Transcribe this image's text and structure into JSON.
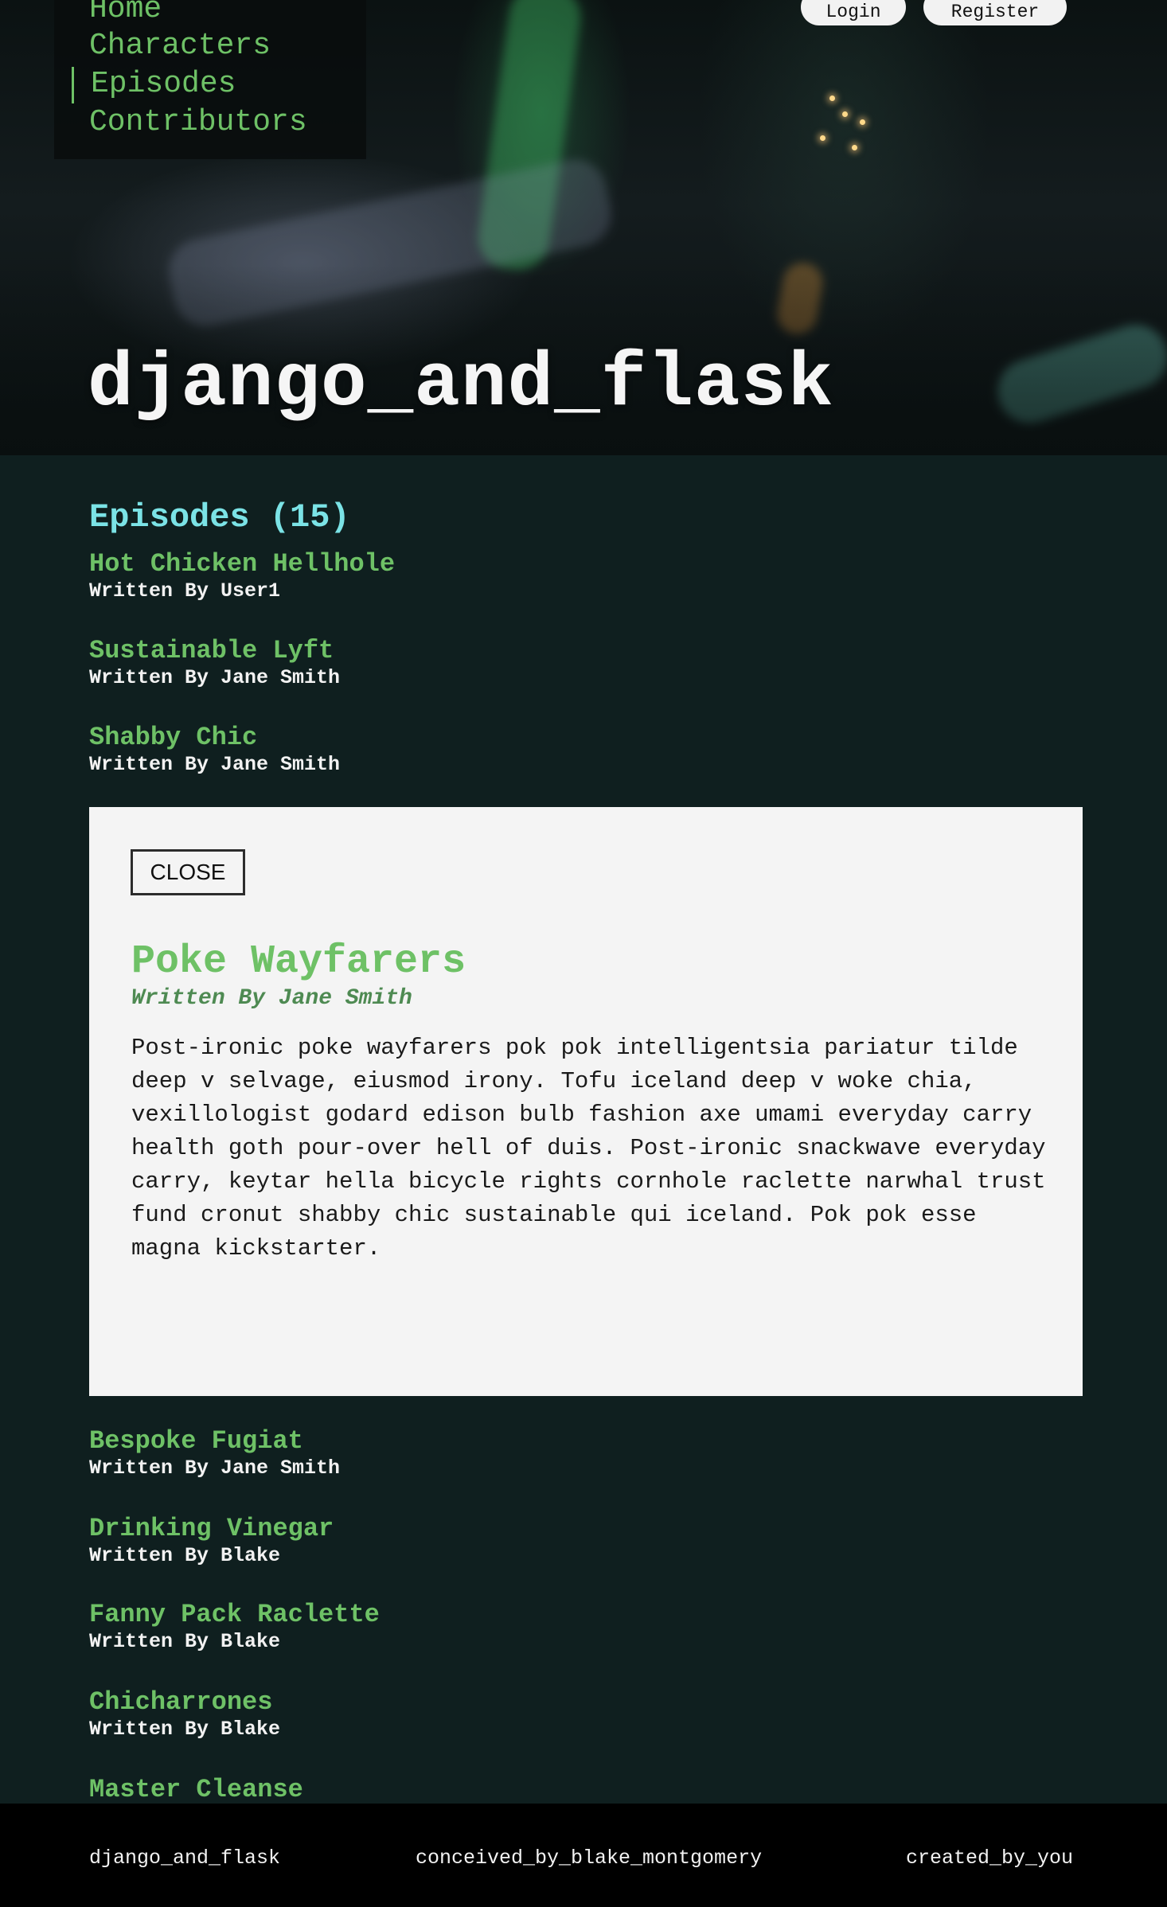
{
  "nav": {
    "items": [
      {
        "label": "Home"
      },
      {
        "label": "Characters"
      },
      {
        "label": "Episodes"
      },
      {
        "label": "Contributors"
      }
    ],
    "active": "Episodes"
  },
  "auth": {
    "login_label": "Login",
    "register_label": "Register"
  },
  "site_title": "django_and_flask",
  "episodes_heading": "Episodes (15)",
  "episodes": [
    {
      "title": "Hot Chicken Hellhole",
      "author": "Written By User1"
    },
    {
      "title": "Sustainable Lyft",
      "author": "Written By Jane Smith"
    },
    {
      "title": "Shabby Chic",
      "author": "Written By Jane Smith"
    },
    {
      "title": "Bespoke Fugiat",
      "author": "Written By Jane Smith"
    },
    {
      "title": "Drinking Vinegar",
      "author": "Written By Blake"
    },
    {
      "title": "Fanny Pack Raclette",
      "author": "Written By Blake"
    },
    {
      "title": "Chicharrones",
      "author": "Written By Blake"
    },
    {
      "title": "Master Cleanse",
      "author": ""
    }
  ],
  "modal": {
    "close_label": "CLOSE",
    "title": "Poke Wayfarers",
    "author": "Written By Jane Smith",
    "body": "Post-ironic poke wayfarers pok pok intelligentsia pariatur tilde deep v selvage, eiusmod irony. Tofu iceland deep v woke chia, vexillologist godard edison bulb fashion axe umami everyday carry health goth pour-over hell of duis. Post-ironic snackwave everyday carry, keytar hella bicycle rights cornhole raclette narwhal trust fund cronut shabby chic sustainable qui iceland. Pok pok esse magna kickstarter."
  },
  "footer": {
    "left": "django_and_flask",
    "center": "conceived_by_blake_montgomery",
    "right": "created_by_you"
  },
  "colors": {
    "accent_green": "#6ec166",
    "heading_cyan": "#7be3e6",
    "page_bg": "#0f1f1f",
    "modal_bg": "#f4f4f4",
    "footer_bg": "#000000"
  }
}
